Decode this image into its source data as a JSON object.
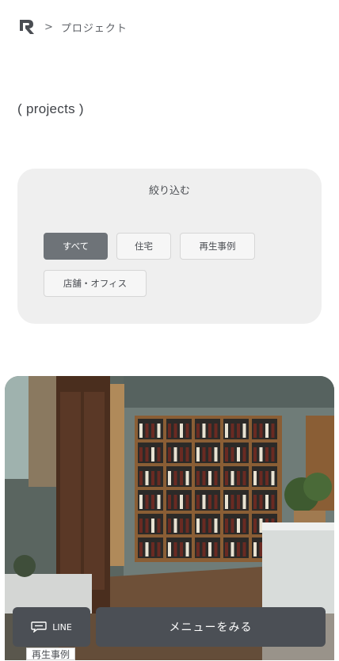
{
  "breadcrumb": {
    "separator": ">",
    "current": "プロジェクト"
  },
  "section": {
    "title": "( projects )"
  },
  "filter": {
    "title": "絞り込む",
    "options": [
      {
        "label": "すべて",
        "active": true
      },
      {
        "label": "住宅",
        "active": false
      },
      {
        "label": "再生事例",
        "active": false
      },
      {
        "label": "店舗・オフィス",
        "active": false
      }
    ]
  },
  "project_card": {
    "category_badge": "再生事例"
  },
  "bottom_bar": {
    "line_label": "LINE",
    "menu_label": "メニューをみる"
  },
  "colors": {
    "accent": "#6e7378",
    "button_bg": "#4b4f55",
    "filter_bg": "#efefef"
  },
  "icons": {
    "logo": "brand-logo",
    "line": "chat-bubble-icon"
  }
}
